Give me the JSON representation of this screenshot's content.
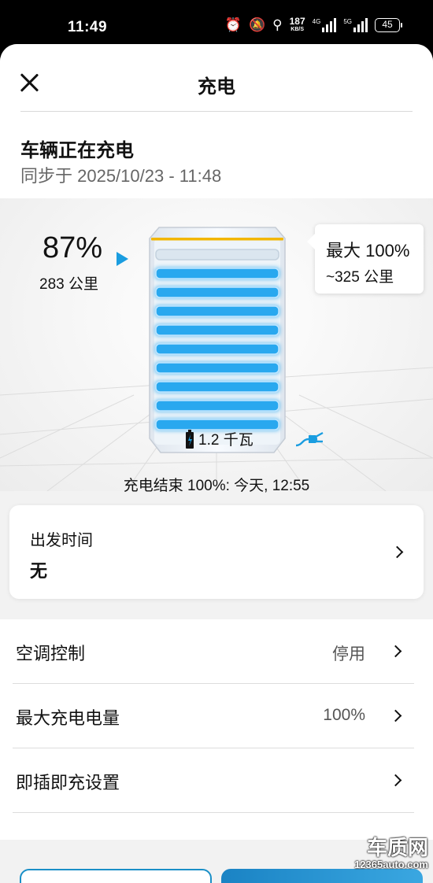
{
  "status_bar": {
    "time": "11:49",
    "icons": [
      "alarm-icon",
      "mute-icon",
      "location-icon"
    ],
    "net_speed_value": "187",
    "net_speed_unit": "KB/S",
    "signal_4g_label": "4G",
    "signal_5g_label": "5G",
    "battery_level": "45"
  },
  "header": {
    "title": "充电",
    "status_title": "车辆正在充电",
    "sync_text": "同步于 2025/10/23 - 11:48"
  },
  "charge": {
    "percent": "87%",
    "range": "283 公里",
    "level_fraction": 0.87,
    "max_line1": "最大 100%",
    "max_line2": "~325 公里",
    "power": "1.2 千瓦",
    "end_text": "充电结束 100%:  今天,   12:55",
    "bar_color": "#29a8ef",
    "limit_color": "#f2b600"
  },
  "departure": {
    "label": "出发时间",
    "value": "无"
  },
  "settings": [
    {
      "label": "空调控制",
      "value": "停用"
    },
    {
      "label": "最大充电电量",
      "value": "100%"
    },
    {
      "label": "即插即充设置",
      "value": ""
    }
  ],
  "watermark": {
    "logo": "车质网",
    "url": "12365auto.com"
  }
}
